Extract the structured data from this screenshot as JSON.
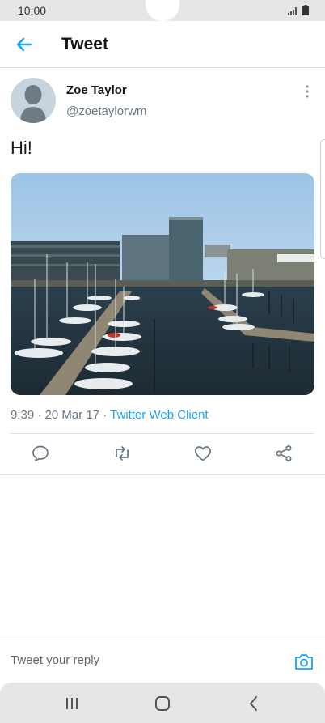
{
  "status_bar": {
    "time": "10:00"
  },
  "header": {
    "title": "Tweet",
    "back_icon": "arrow-left-icon"
  },
  "tweet": {
    "author_name": "Zoe Taylor",
    "author_handle": "@zoetaylorwm",
    "text": "Hi!",
    "time": "9:39",
    "date": "20 Mar 17",
    "separator": "·",
    "client": "Twitter Web Client",
    "photo_icon": "harbor-photo"
  },
  "actions": [
    {
      "name": "reply",
      "icon": "reply-icon"
    },
    {
      "name": "retweet",
      "icon": "retweet-icon"
    },
    {
      "name": "like",
      "icon": "heart-icon"
    },
    {
      "name": "share",
      "icon": "share-icon"
    }
  ],
  "reply": {
    "placeholder": "Tweet your reply"
  },
  "colors": {
    "accent": "#1da1f2",
    "text": "#14171a",
    "muted": "#657786",
    "chrome": "#e6e6e6"
  }
}
